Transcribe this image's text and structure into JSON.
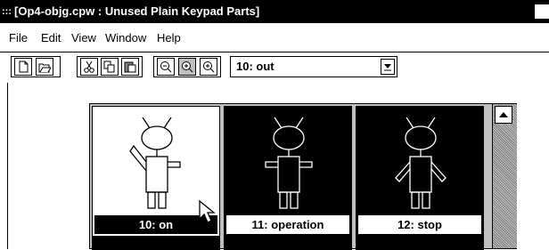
{
  "window": {
    "title": "[Op4-objg.cpw : Unused Plain Keypad Parts]",
    "icon": "app-window-icon"
  },
  "menu": [
    {
      "label": "File"
    },
    {
      "label": "Edit"
    },
    {
      "label": "View"
    },
    {
      "label": "Window"
    },
    {
      "label": "Help"
    }
  ],
  "toolbar": {
    "combo_value": "10: out",
    "icons": [
      "new-file-icon",
      "open-file-icon",
      "cut-icon",
      "copy-icon",
      "paste-icon",
      "zoom-out-icon",
      "zoom-fit-icon",
      "zoom-in-icon"
    ]
  },
  "parts": [
    {
      "label": "10: on",
      "selected": true
    },
    {
      "label": "11: operation",
      "selected": false
    },
    {
      "label": "12: stop",
      "selected": false
    }
  ],
  "colors": {
    "dark": "#000000",
    "panel": "#c0c0c0"
  }
}
